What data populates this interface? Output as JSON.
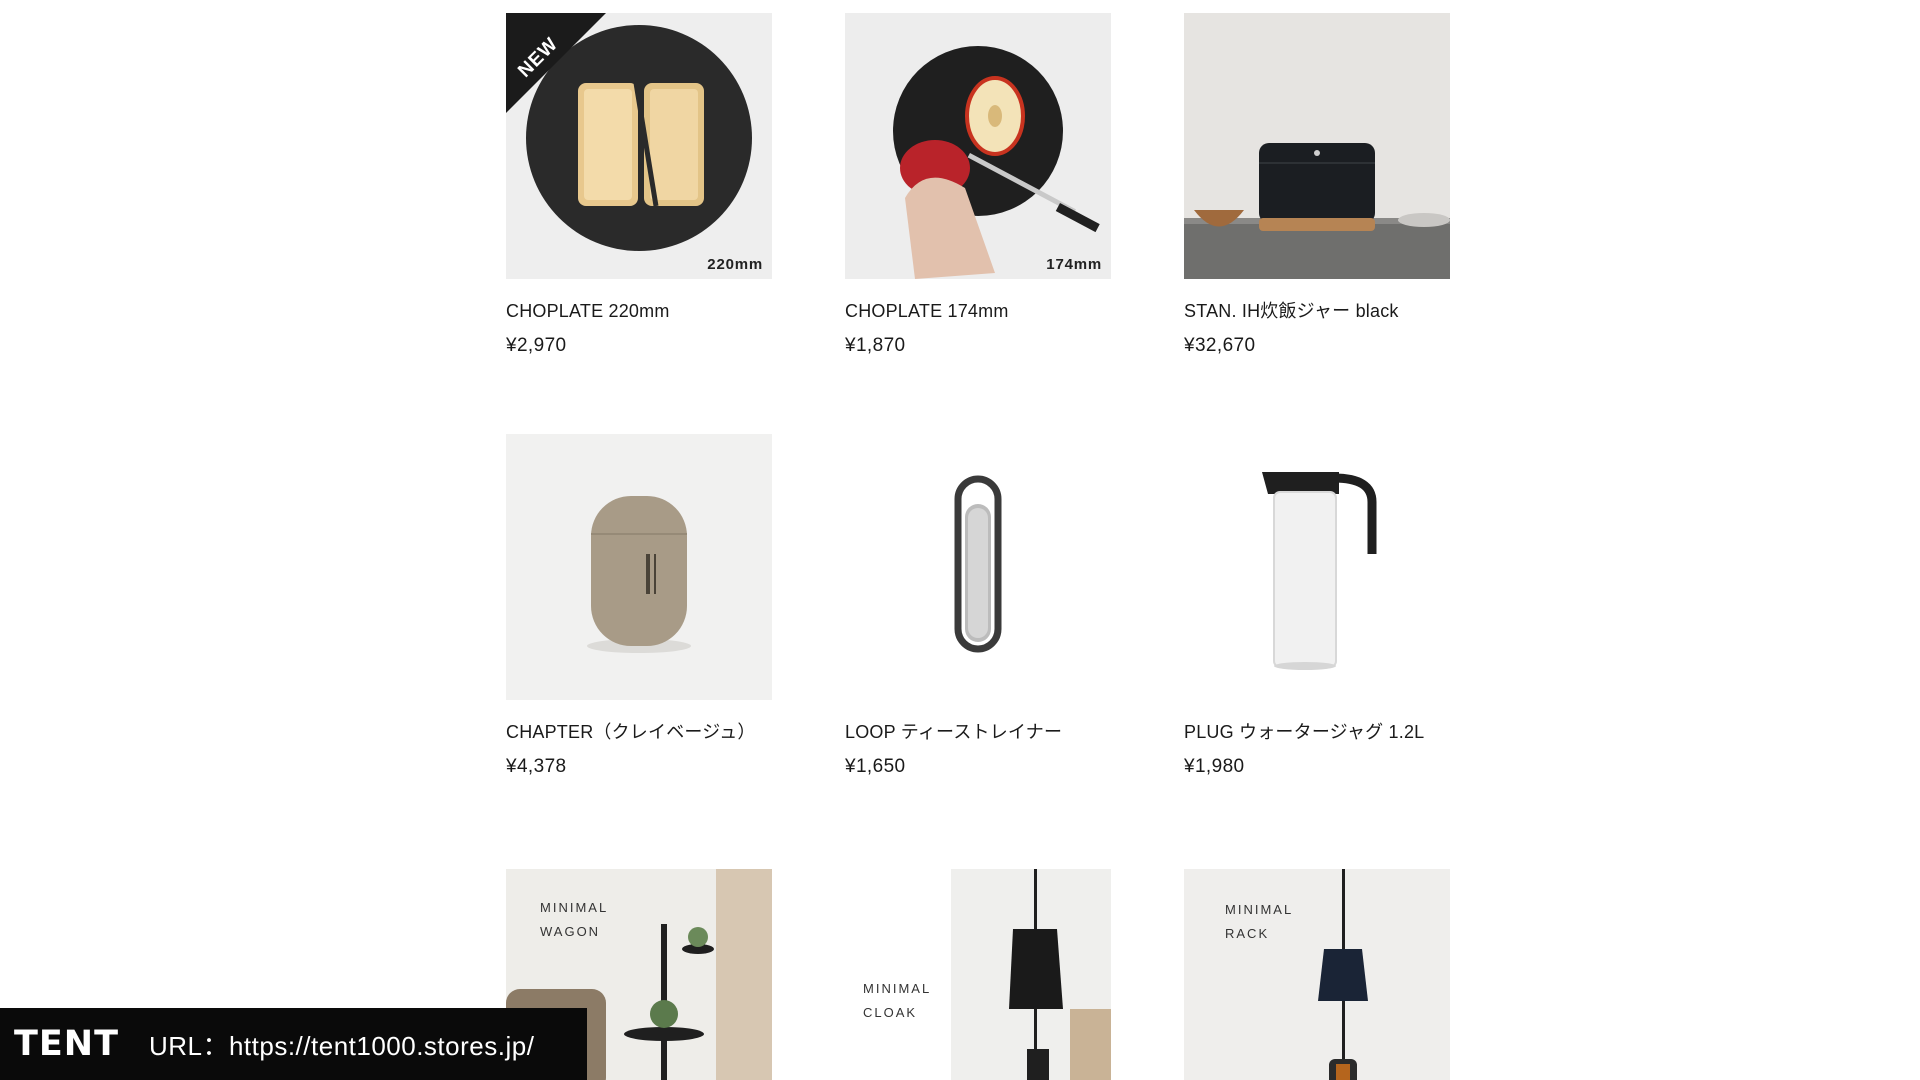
{
  "products": [
    {
      "name": "CHOPLATE 220mm",
      "price": "¥2,970",
      "badge": "NEW",
      "size_label": "220mm"
    },
    {
      "name": "CHOPLATE 174mm",
      "price": "¥1,870",
      "size_label": "174mm"
    },
    {
      "name": "STAN. IH炊飯ジャー black",
      "price": "¥32,670"
    },
    {
      "name": "CHAPTER（クレイベージュ）",
      "price": "¥4,378"
    },
    {
      "name": "LOOP ティーストレイナー",
      "price": "¥1,650"
    },
    {
      "name": "PLUG ウォータージャグ 1.2L",
      "price": "¥1,980"
    },
    {
      "overlay": "MINIMAL\nWAGON"
    },
    {
      "overlay": "MINIMAL\nCLOAK"
    },
    {
      "overlay": "MINIMAL\nRACK"
    }
  ],
  "footer": {
    "brand": "TENT",
    "url_text": "URL：https://tent1000.stores.jp/"
  },
  "colors": {
    "badge": "#1b1b1b",
    "footer_bg": "#0a0a0a",
    "text": "#1a1a1a"
  }
}
